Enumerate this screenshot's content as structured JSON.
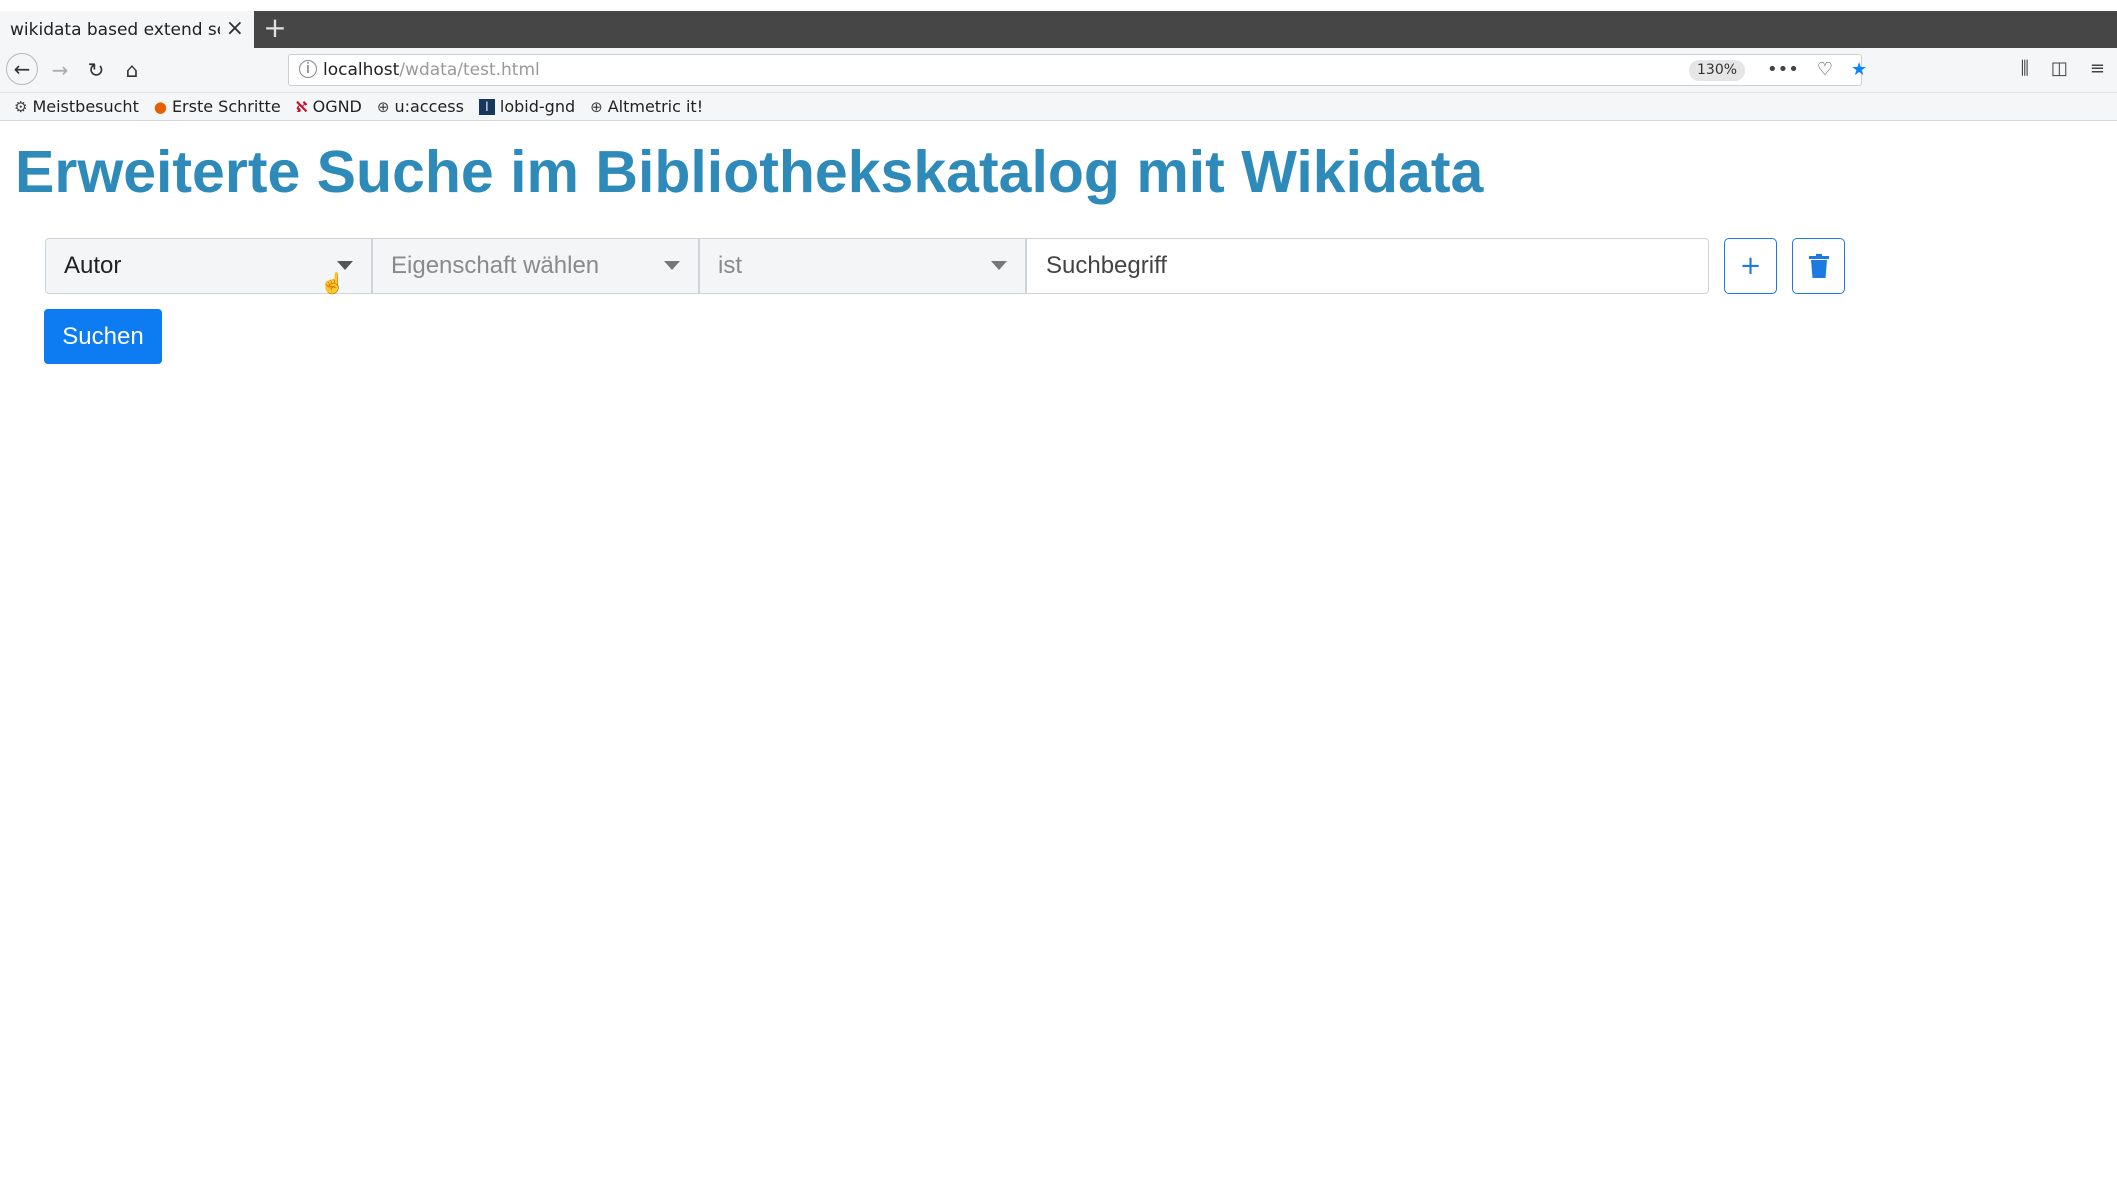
{
  "browser": {
    "tab_title": "wikidata based extend sea",
    "new_tab": "+",
    "url_host": "localhost",
    "url_path": "/wdata/test.html",
    "zoom": "130%",
    "bookmarks": [
      {
        "label": "Meistbesucht",
        "icon": "gear-icon"
      },
      {
        "label": "Erste Schritte",
        "icon": "firefox-icon"
      },
      {
        "label": "OGND",
        "icon": "gnd-icon"
      },
      {
        "label": "u:access",
        "icon": "globe-icon"
      },
      {
        "label": "lobid-gnd",
        "icon": "lobid-icon"
      },
      {
        "label": "Altmetric it!",
        "icon": "globe-icon"
      }
    ]
  },
  "page": {
    "title": "Erweiterte Suche im Bibliothekskatalog mit Wikidata",
    "author_select": "Autor",
    "property_select": "Eigenschaft wählen",
    "operator_select": "ist",
    "search_placeholder": "Suchbegriff",
    "add_label": "+",
    "search_button": "Suchen"
  },
  "colors": {
    "title": "#2e8ab8",
    "primary": "#0d7cf2",
    "outline": "#1e7ae0"
  }
}
